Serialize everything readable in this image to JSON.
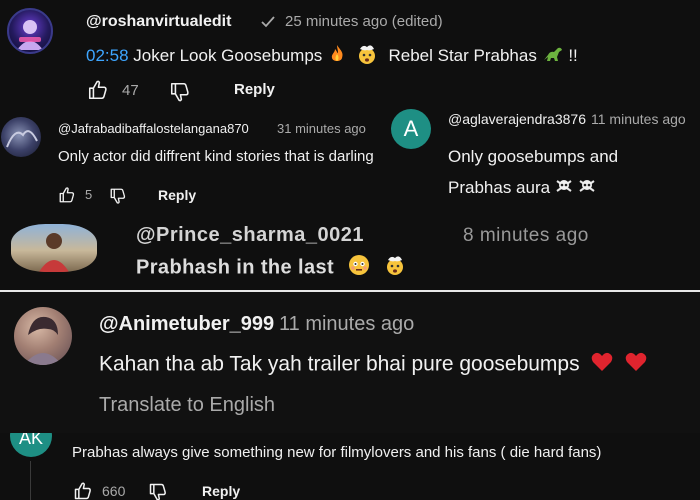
{
  "c1": {
    "handle": "@roshanvirtualedit",
    "time": "25 minutes ago (edited)",
    "timestamp": "02:58",
    "text_a": "Joker Look Goosebumps",
    "text_b": "Rebel Star Prabhas",
    "text_c": "!!",
    "likes": "47",
    "reply": "Reply"
  },
  "c2": {
    "handle": "@Jafrabadibaffalostelangana870",
    "time": "31 minutes ago",
    "text": "Only actor did diffrent kind stories that is darling",
    "likes": "5",
    "reply": "Reply"
  },
  "c3": {
    "avatar_letter": "A",
    "handle": "@aglaverajendra3876",
    "time": "11 minutes ago",
    "line1": "Only goosebumps and",
    "line2": "Prabhas aura"
  },
  "c4": {
    "handle": "@Prince_sharma_0021",
    "time": "8 minutes ago",
    "text": "Prabhash in the last"
  },
  "c5": {
    "handle": "@Animetuber_999",
    "time": "11 minutes ago",
    "text": "Kahan tha ab Tak yah trailer bhai pure goosebumps",
    "translate": "Translate to English"
  },
  "c6": {
    "avatar_letter": "AK",
    "text": "Prabhas always give something new for filmylovers and his fans ( die hard fans)",
    "likes": "660",
    "reply": "Reply"
  },
  "colors": {
    "background": "#0f0f0f",
    "timestamp_link": "#3ea6ff",
    "avatar_teal": "#1e8f84",
    "heart": "#e0242e"
  }
}
